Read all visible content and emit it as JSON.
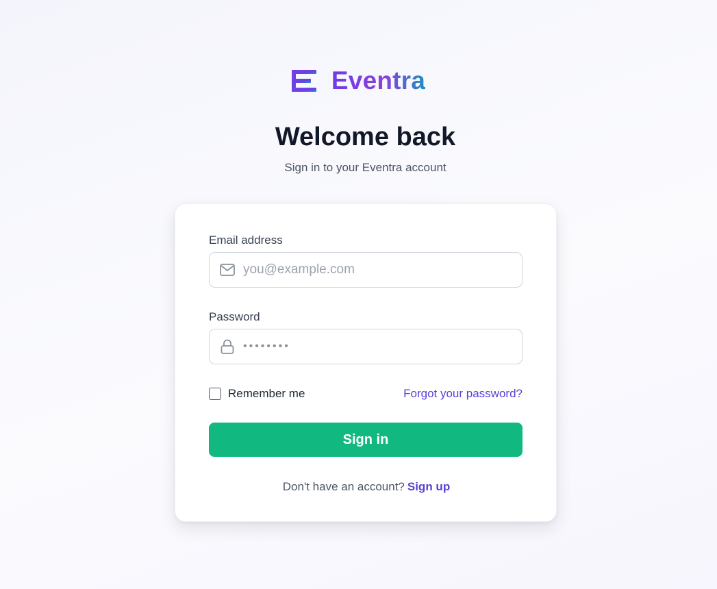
{
  "brand": {
    "name": "Eventra",
    "gradient": [
      "#6d3ce8",
      "#8b3fd9",
      "#1d8fbf"
    ]
  },
  "header": {
    "title": "Welcome back",
    "subtitle": "Sign in to your Eventra account"
  },
  "form": {
    "email": {
      "label": "Email address",
      "placeholder": "you@example.com",
      "value": "",
      "icon": "mail-icon"
    },
    "password": {
      "label": "Password",
      "value_masked": "••••••••",
      "icon": "lock-icon"
    },
    "remember_label": "Remember me",
    "remember_checked": false,
    "forgot_label": "Forgot your password?",
    "submit_label": "Sign in",
    "signup_prompt": "Don't have an account?",
    "signup_label": "Sign up"
  },
  "colors": {
    "primary_button": "#11b981",
    "link": "#5b3fd6",
    "heading": "#111827"
  }
}
